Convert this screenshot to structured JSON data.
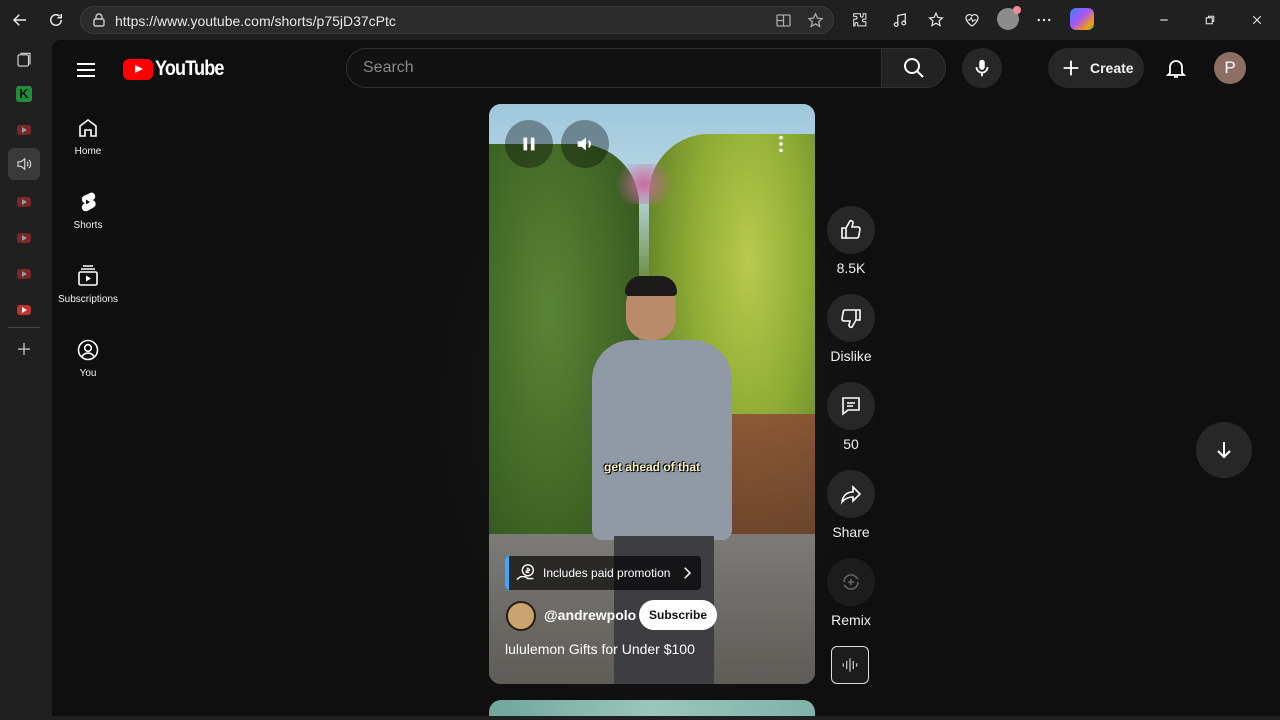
{
  "browser": {
    "url": "https://www.youtube.com/shorts/p75jD37cPtc",
    "toolbar_icons": [
      "back-icon",
      "refresh-icon",
      "site-info-icon",
      "split-screen-icon",
      "favorite-star-icon",
      "extensions-icon",
      "media-control-icon",
      "favorites-icon",
      "browser-essentials-icon",
      "profile-icon",
      "more-icon",
      "copilot-icon",
      "minimize-icon",
      "restore-icon",
      "close-icon"
    ]
  },
  "side_rail": {
    "items": [
      "tab-actions-icon",
      "k-app-icon",
      "youtube-tab-icon",
      "audio-tab-icon",
      "youtube-tab-icon",
      "youtube-tab-icon",
      "youtube-tab-icon",
      "youtube-tab-icon",
      "add-tab-icon"
    ]
  },
  "youtube": {
    "logo_text": "YouTube",
    "search_placeholder": "Search",
    "create_label": "Create",
    "avatar_letter": "P",
    "nav": [
      {
        "label": "Home",
        "icon": "home-icon"
      },
      {
        "label": "Shorts",
        "icon": "shorts-icon"
      },
      {
        "label": "Subscriptions",
        "icon": "subscriptions-icon"
      },
      {
        "label": "You",
        "icon": "account-icon"
      }
    ]
  },
  "short": {
    "caption": "get ahead of that",
    "promo_label": "Includes paid promotion",
    "channel": "@andrewpolo",
    "subscribe_label": "Subscribe",
    "title": "lululemon Gifts for Under $100",
    "actions": {
      "likes": "8.5K",
      "dislike_label": "Dislike",
      "comments": "50",
      "share_label": "Share",
      "remix_label": "Remix"
    }
  },
  "colors": {
    "brand_red": "#ff0000",
    "page_bg": "#0f0f0f",
    "accent_blue": "#3ea6ff"
  }
}
